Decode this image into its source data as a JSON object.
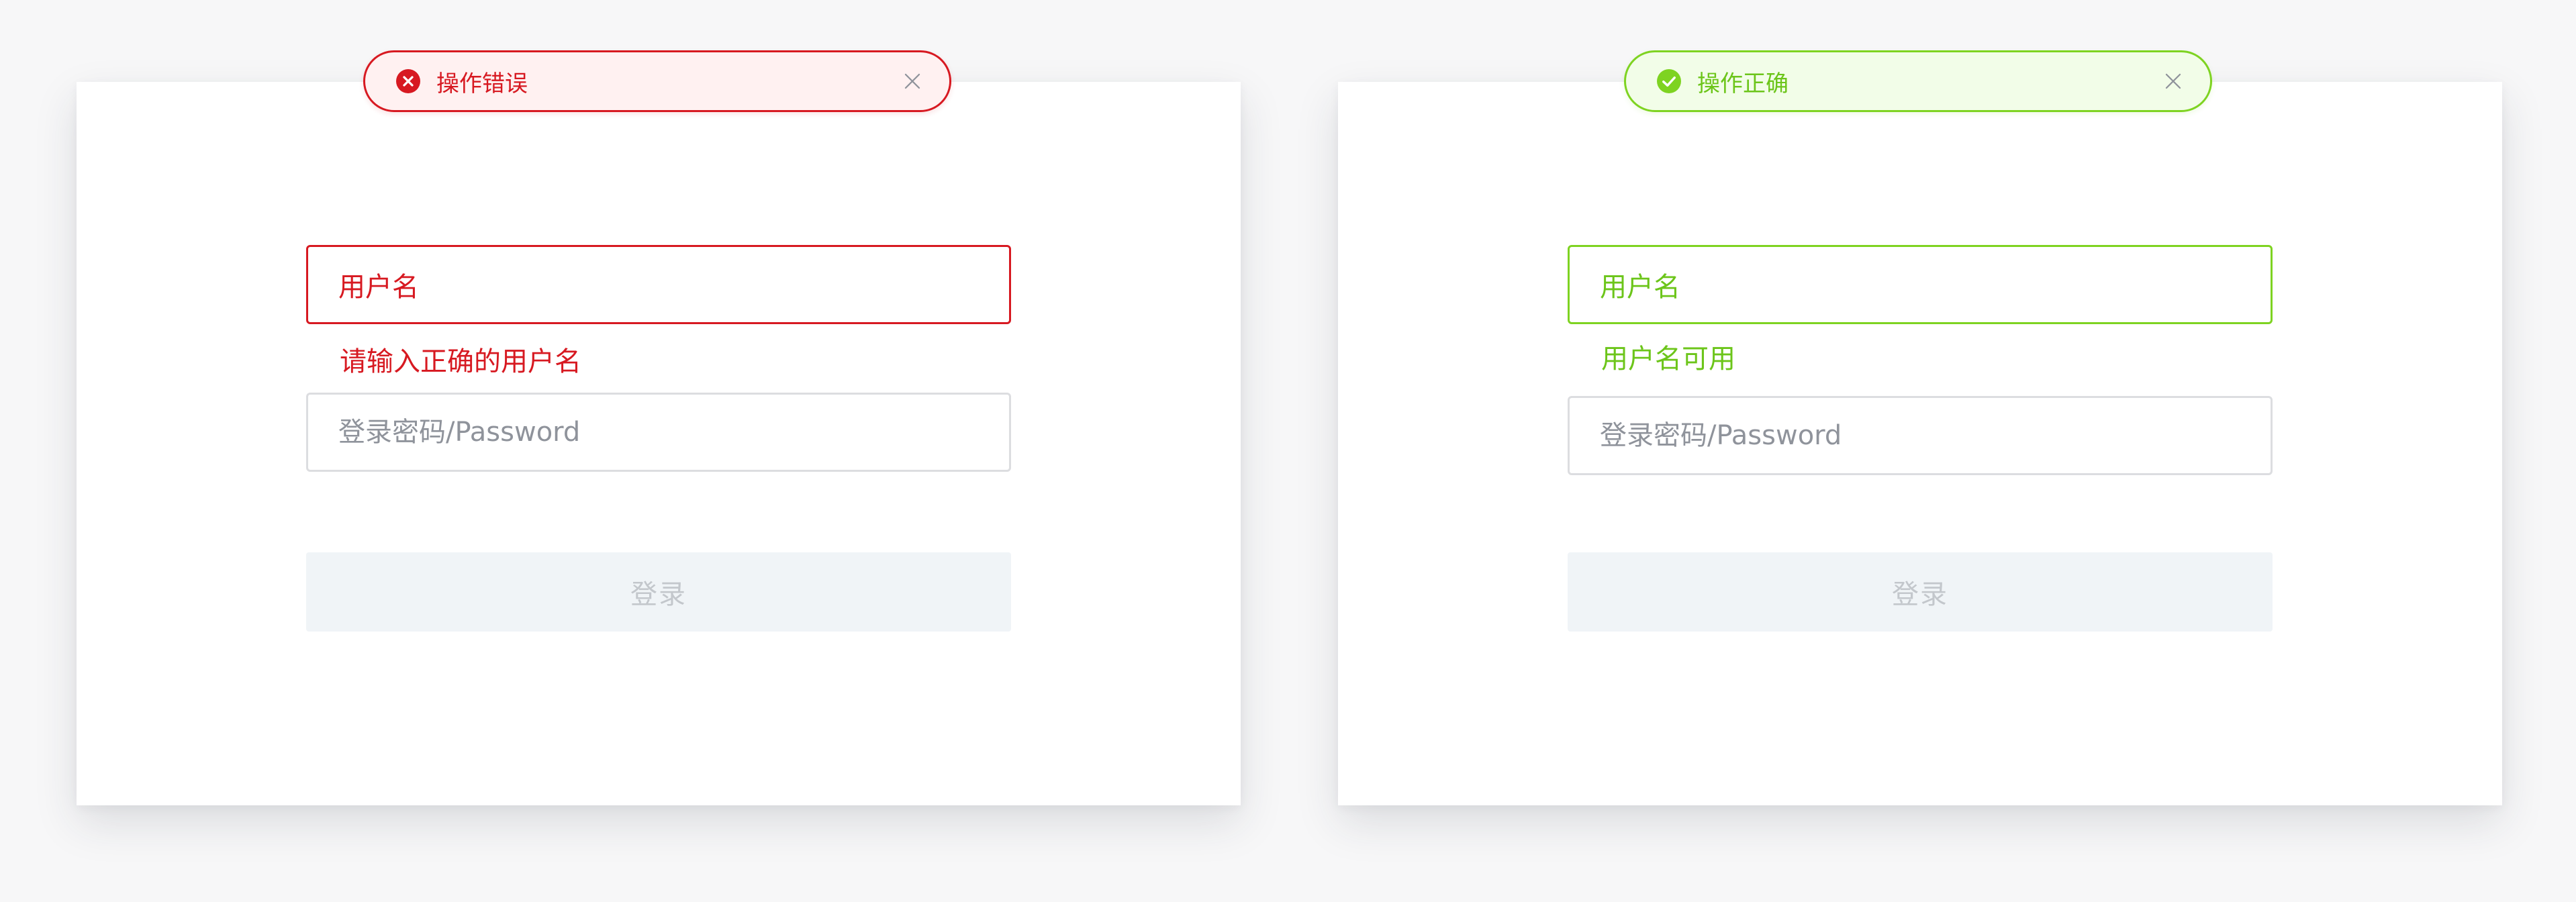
{
  "colors": {
    "page_background": "#f7f7f8",
    "card_background": "#ffffff",
    "error": "#d71921",
    "error_toast_background": "#fff1f1",
    "success": "#7ed321",
    "success_text": "#6cc51a",
    "success_toast_background": "#f2fde8",
    "input_border": "#dcdde0",
    "placeholder": "#8f939b",
    "button_disabled_background": "#f0f4f7",
    "button_disabled_text": "#c3c7cc"
  },
  "error_panel": {
    "toast": {
      "icon": "error-circle-icon",
      "message": "操作错误",
      "close_icon": "close-icon"
    },
    "username": {
      "value": "用户名",
      "state": "error",
      "helper": "请输入正确的用户名"
    },
    "password": {
      "placeholder": "登录密码/Password",
      "value": ""
    },
    "login_button": {
      "label": "登录",
      "disabled": true
    }
  },
  "success_panel": {
    "toast": {
      "icon": "success-check-circle-icon",
      "message": "操作正确",
      "close_icon": "close-icon"
    },
    "username": {
      "value": "用户名",
      "state": "success",
      "helper": "用户名可用"
    },
    "password": {
      "placeholder": "登录密码/Password",
      "value": ""
    },
    "login_button": {
      "label": "登录",
      "disabled": true
    }
  }
}
